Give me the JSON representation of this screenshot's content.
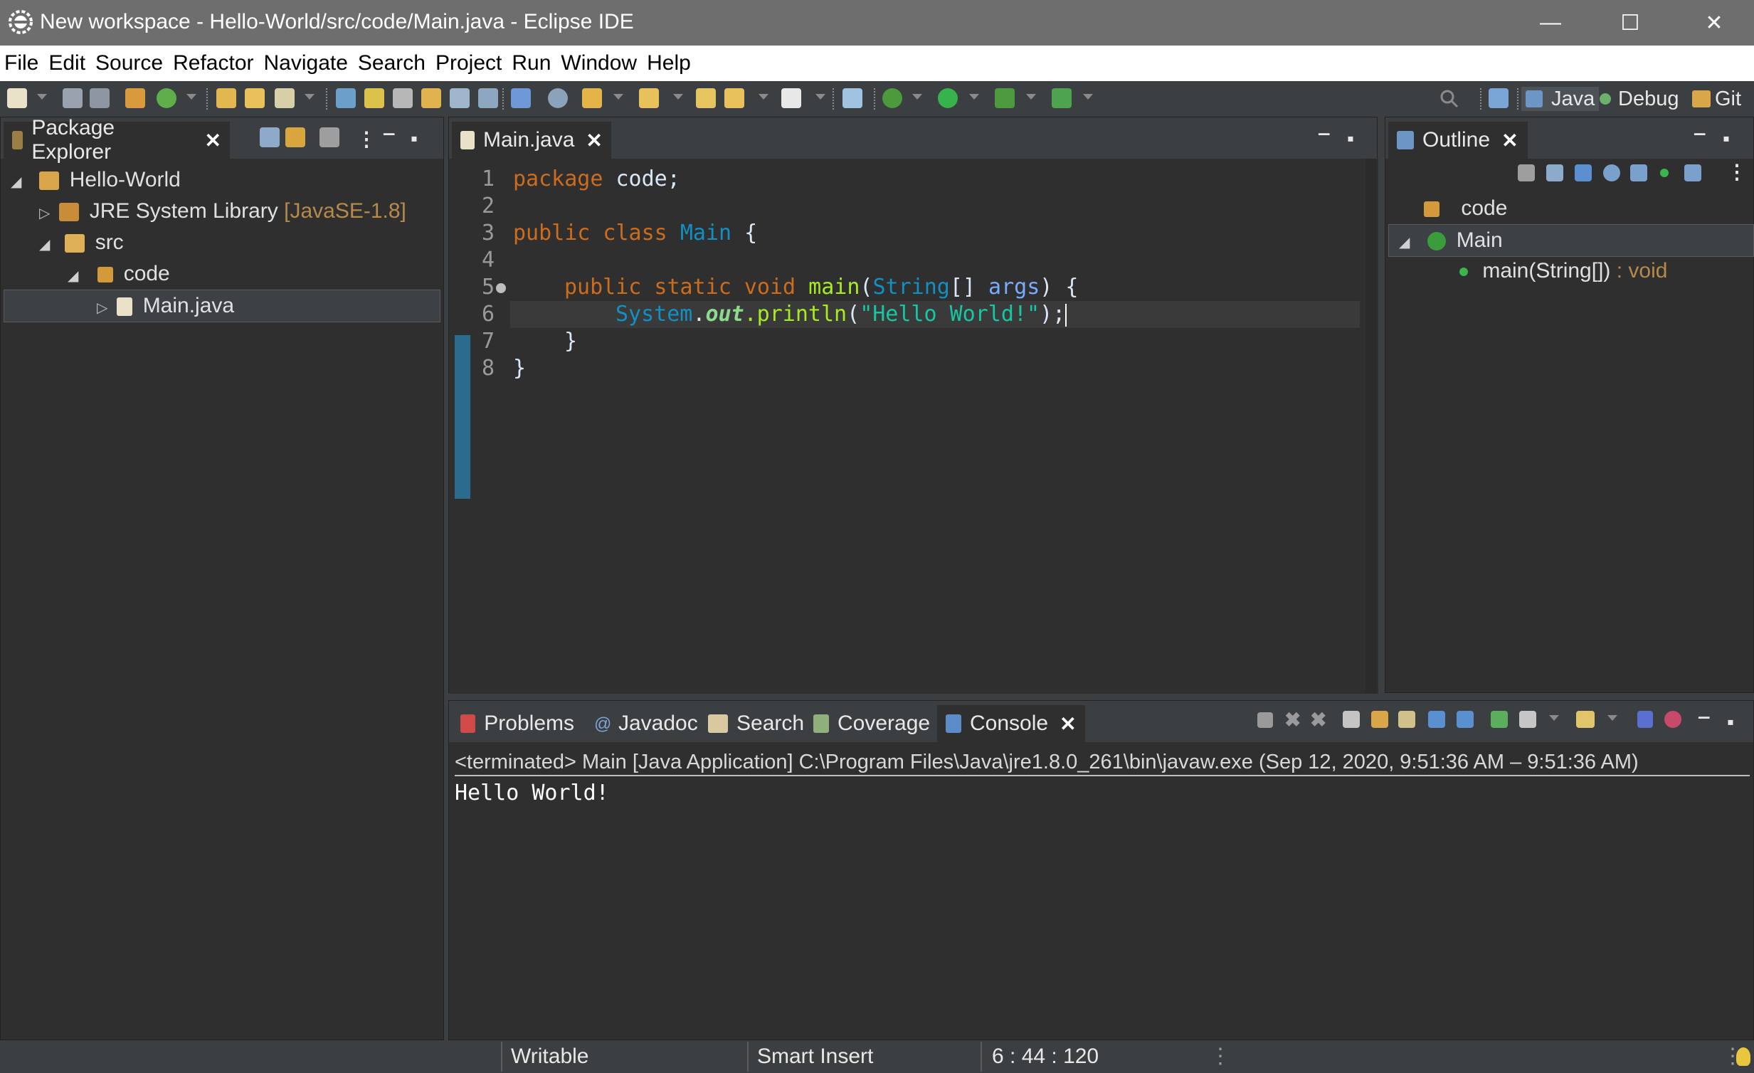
{
  "window": {
    "title": "New workspace - Hello-World/src/code/Main.java - Eclipse IDE",
    "minimize": "—",
    "maximize": "☐",
    "close": "✕"
  },
  "menu": [
    "File",
    "Edit",
    "Source",
    "Refactor",
    "Navigate",
    "Search",
    "Project",
    "Run",
    "Window",
    "Help"
  ],
  "perspectives": [
    {
      "label": "Java",
      "icon": "java-perspective-icon",
      "active": true
    },
    {
      "label": "Debug",
      "icon": "debug-perspective-icon",
      "active": false
    },
    {
      "label": "Git",
      "icon": "git-perspective-icon",
      "active": false
    }
  ],
  "package_explorer": {
    "tab_label": "Package Explorer",
    "tree": [
      {
        "label": "Hello-World",
        "icon": "java-project-icon",
        "expanded": true
      },
      {
        "label": "JRE System Library",
        "suffix": "[JavaSE-1.8]",
        "icon": "library-icon",
        "expanded": false
      },
      {
        "label": "src",
        "icon": "source-folder-icon",
        "expanded": true
      },
      {
        "label": "code",
        "icon": "package-icon",
        "expanded": true
      },
      {
        "label": "Main.java",
        "icon": "java-file-icon",
        "expanded": false,
        "selected": true
      }
    ]
  },
  "editor": {
    "tab_label": "Main.java",
    "line_numbers": [
      "1",
      "2",
      "3",
      "4",
      "5",
      "6",
      "7",
      "8"
    ],
    "code": {
      "l1_kw": "package",
      "l1_rest": " code;",
      "l3_kw": "public class",
      "l3_cls": "Main",
      "l3_rest": " {",
      "l5_kw": "public static void",
      "l5_fn": "main",
      "l5_open": "(",
      "l5_type": "String",
      "l5_mid": "[] ",
      "l5_par": "args",
      "l5_rest": ") {",
      "l6_cls": "System",
      "l6_dot": ".",
      "l6_fld": "out",
      "l6_fn": ".println",
      "l6_open": "(",
      "l6_str": "\"Hello World!\"",
      "l6_rest": ");",
      "l7": "}",
      "l8": "}"
    }
  },
  "outline": {
    "tab_label": "Outline",
    "items": [
      {
        "label": "code",
        "icon": "package-icon"
      },
      {
        "label": "Main",
        "icon": "class-icon",
        "selected": true
      },
      {
        "label": "main(String[])",
        "suffix": " : void",
        "icon": "public-static-method-icon"
      }
    ]
  },
  "bottom_tabs": [
    {
      "label": "Problems",
      "icon": "problems-icon"
    },
    {
      "label": "Javadoc",
      "icon": "javadoc-icon"
    },
    {
      "label": "Search",
      "icon": "search-icon"
    },
    {
      "label": "Coverage",
      "icon": "coverage-icon"
    },
    {
      "label": "Console",
      "icon": "console-icon",
      "active": true
    }
  ],
  "console": {
    "header": "<terminated> Main [Java Application] C:\\Program Files\\Java\\jre1.8.0_261\\bin\\javaw.exe  (Sep 12, 2020, 9:51:36 AM – 9:51:36 AM)",
    "output": "Hello World!"
  },
  "status": {
    "writable": "Writable",
    "insert_mode": "Smart Insert",
    "position": "6 : 44 : 120"
  },
  "colors": {
    "keyword": "#cc6c1d",
    "class": "#1290c3",
    "method": "#a7ec21",
    "string": "#17c6a3",
    "background": "#2f2f2f"
  }
}
